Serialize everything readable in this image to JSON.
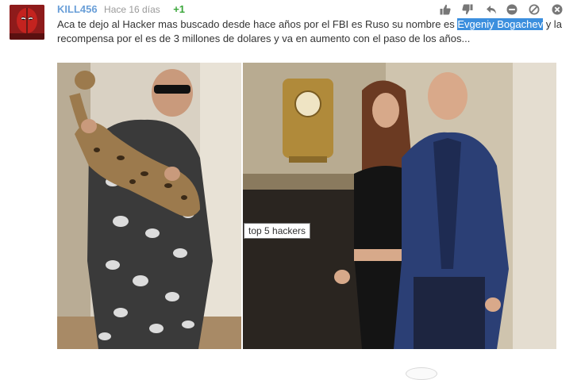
{
  "comment": {
    "username": "KILL456",
    "time": "Hace 16 días",
    "votes": "+1",
    "text_before": "Aca te dejo al Hacker mas buscado desde hace años por el FBI es Ruso su nombre es ",
    "text_highlight": "Evgeniy Bogachev",
    "text_after": " y la recompensa por el es de 3 millones de dolares y va en aumento con el paso de los años...",
    "tooltip": "top 5 hackers"
  },
  "actions": [
    {
      "name": "thumbs-up-icon",
      "label": "like"
    },
    {
      "name": "thumbs-down-icon",
      "label": "dislike"
    },
    {
      "name": "reply-icon",
      "label": "reply"
    },
    {
      "name": "minus-circle-icon",
      "label": "collapse"
    },
    {
      "name": "block-icon",
      "label": "block"
    },
    {
      "name": "close-circle-icon",
      "label": "close"
    }
  ],
  "colors": {
    "username": "#6a9fd8",
    "votes": "#3aa63a",
    "highlight": "#3c8fde",
    "time": "#9a9a9a",
    "text": "#333333"
  }
}
